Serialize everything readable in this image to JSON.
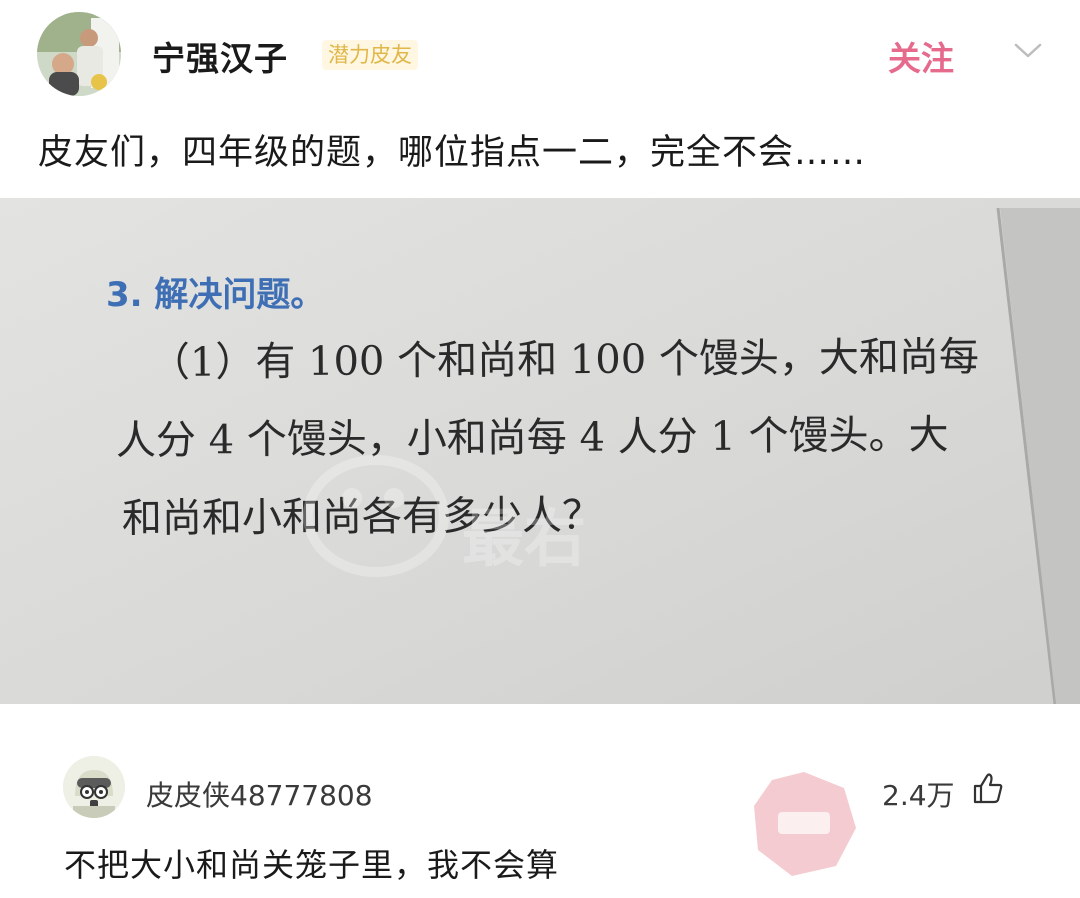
{
  "post": {
    "author": {
      "name": "宁强汉子",
      "badge": "潜力皮友",
      "avatar_icon": "user-avatar-photo"
    },
    "follow_label": "关注",
    "more_icon": "chevron-down-icon",
    "text": "皮友们，四年级的题，哪位指点一二，完全不会……",
    "image": {
      "heading": "3. 解决问题。",
      "lines": [
        "（1）有 100 个和尚和 100 个馒头，大和尚每",
        "人分 4 个馒头，小和尚每 4 人分 1 个馒头。大",
        "和尚和小和尚各有多少人？"
      ],
      "watermark": "最右"
    }
  },
  "comment": {
    "author": "皮皮侠48777808",
    "avatar_icon": "cartoon-avatar",
    "like_count": "2.4万",
    "like_icon": "thumbs-up-icon",
    "text": "不把大小和尚关笼子里，我不会算",
    "sticker_icon": "sticker-icon"
  },
  "colors": {
    "follow": "#e56a8c",
    "badge_text": "#e1b74a",
    "badge_bg": "#fff7e2",
    "text_primary": "#1a1a1a",
    "text_secondary": "#3a3a3a",
    "photo_heading": "#3e6fb5"
  }
}
